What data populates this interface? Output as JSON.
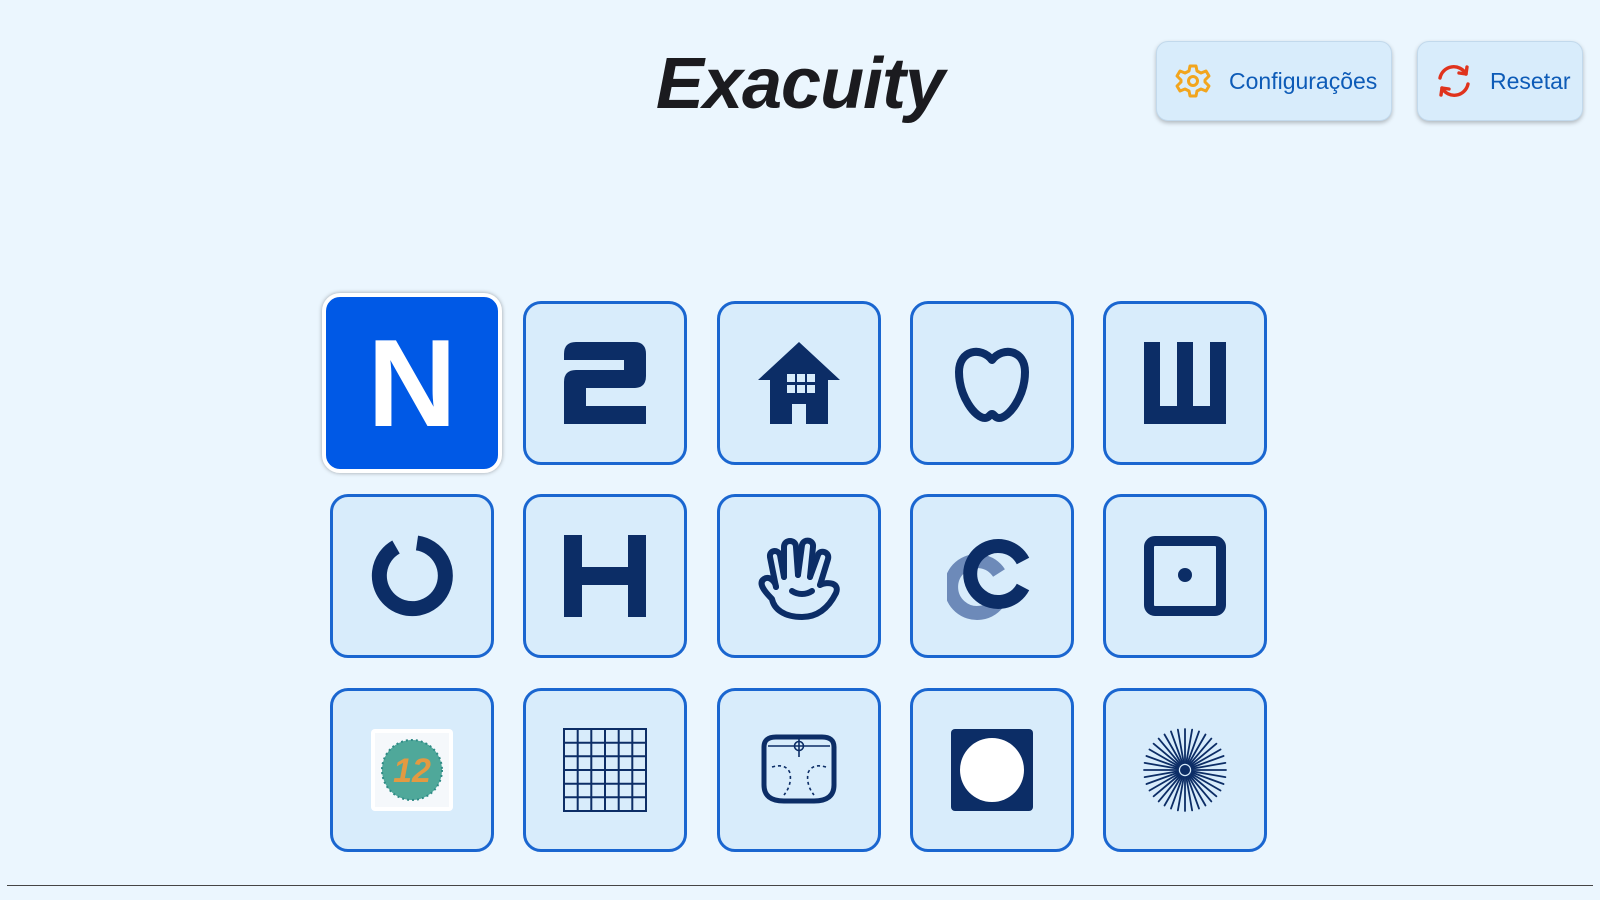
{
  "app": {
    "title": "Exacuity"
  },
  "header": {
    "settings": {
      "label": "Configurações",
      "icon": "gear-icon"
    },
    "reset": {
      "label": "Resetar",
      "icon": "refresh-icon"
    }
  },
  "tiles": [
    {
      "icon": "letter-n-icon",
      "glyph": "N",
      "selected": true
    },
    {
      "icon": "number-2-icon",
      "glyph": "2"
    },
    {
      "icon": "house-icon"
    },
    {
      "icon": "apple-icon"
    },
    {
      "icon": "tumbling-e-icon"
    },
    {
      "icon": "landolt-c-icon"
    },
    {
      "icon": "letter-h-icon",
      "glyph": "H"
    },
    {
      "icon": "hand-icon"
    },
    {
      "icon": "contrast-c-icon"
    },
    {
      "icon": "square-dot-icon"
    },
    {
      "icon": "color-plate-icon",
      "glyph": "12"
    },
    {
      "icon": "amsler-grid-icon"
    },
    {
      "icon": "fixation-target-icon"
    },
    {
      "icon": "white-circle-icon"
    },
    {
      "icon": "astigmatism-dial-icon"
    }
  ],
  "colors": {
    "background": "#ebf6fe",
    "tile_bg": "#d8ecfb",
    "tile_border": "#1a66d0",
    "selected_bg": "#0059e6",
    "glyph": "#0c2d66",
    "accent_text": "#0d5bb7",
    "gear": "#f2a51d",
    "refresh": "#e0331d"
  }
}
